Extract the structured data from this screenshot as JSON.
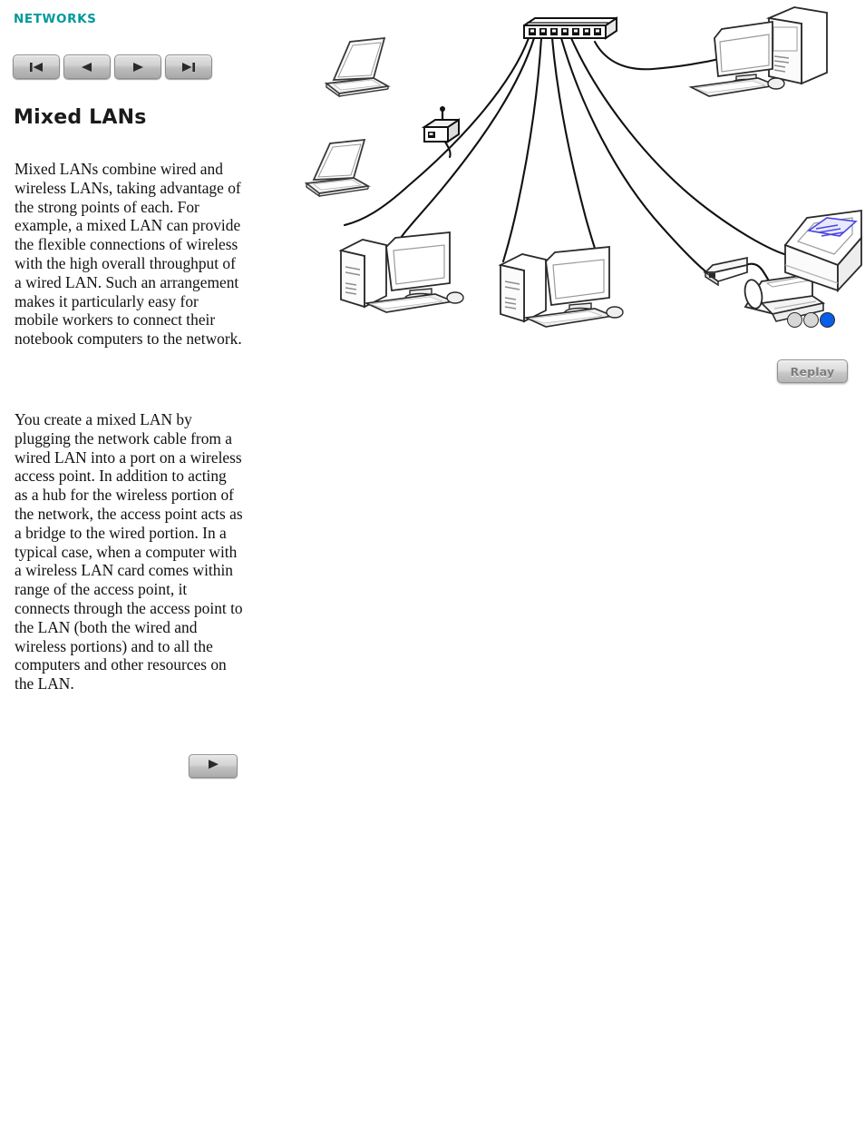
{
  "section": {
    "label": "NETWORKS"
  },
  "nav": {
    "buttons": [
      {
        "name": "first",
        "icon": "skip-back-icon",
        "label": "First"
      },
      {
        "name": "previous",
        "icon": "rewind-icon",
        "label": "Previous"
      },
      {
        "name": "next",
        "icon": "play-icon",
        "label": "Next"
      },
      {
        "name": "last",
        "icon": "skip-forward-icon",
        "label": "Last"
      }
    ]
  },
  "page": {
    "title": "Mixed LANs",
    "paragraphs": [
      "Mixed LANs combine wired and wireless LANs, taking advantage of the strong points of each. For example, a mixed LAN can provide the flexible connections of wireless with the high overall throughput of a wired LAN. Such an arrangement makes it particularly easy for mobile workers to connect their notebook computers to the network.",
      "You create a mixed LAN by plugging the network cable from a wired LAN into a port on a wireless access point. In addition to acting as a hub for the wireless portion of the network, the access point acts as a bridge to the wired portion. In a typical case, when a computer with a wireless LAN card comes within range of the access point, it connects through the access point to the LAN (both the wired and wireless portions) and to all the computers and other resources on the LAN."
    ],
    "continue_button_icon": "play-icon"
  },
  "animation": {
    "replay_label": "Replay",
    "steps_total": 3,
    "current_step": 3,
    "dots": [
      {
        "index": 1,
        "active": false
      },
      {
        "index": 2,
        "active": false
      },
      {
        "index": 3,
        "active": true
      }
    ]
  },
  "diagram": {
    "title": "Mixed LAN topology",
    "nodes": [
      {
        "id": "hub",
        "label": "Network hub / switch",
        "ports": 7
      },
      {
        "id": "laptop-top",
        "label": "Notebook computer (wireless)"
      },
      {
        "id": "laptop-lower",
        "label": "Notebook computer (wireless)"
      },
      {
        "id": "access-point",
        "label": "Wireless access point"
      },
      {
        "id": "desktop-top-right",
        "label": "Desktop computer"
      },
      {
        "id": "desktop-left",
        "label": "Desktop computer"
      },
      {
        "id": "desktop-center",
        "label": "Desktop computer"
      },
      {
        "id": "print-server",
        "label": "Print server adapter"
      },
      {
        "id": "inkjet-printer",
        "label": "Inkjet printer"
      },
      {
        "id": "laser-printer",
        "label": "Laser printer"
      }
    ],
    "links": [
      {
        "from": "hub",
        "to": "access-point"
      },
      {
        "from": "hub",
        "to": "desktop-left"
      },
      {
        "from": "hub",
        "to": "desktop-center"
      },
      {
        "from": "hub",
        "to": "desktop-top-right"
      },
      {
        "from": "hub",
        "to": "print-server"
      },
      {
        "from": "hub",
        "to": "laser-printer"
      },
      {
        "from": "print-server",
        "to": "inkjet-printer"
      }
    ],
    "colors": {
      "accent_teal": "#009a9a",
      "cable": "#111111",
      "paper_blue": "#4a46e0",
      "dot_active": "#0a5de8",
      "dot_inactive": "#d7d7d7"
    }
  }
}
